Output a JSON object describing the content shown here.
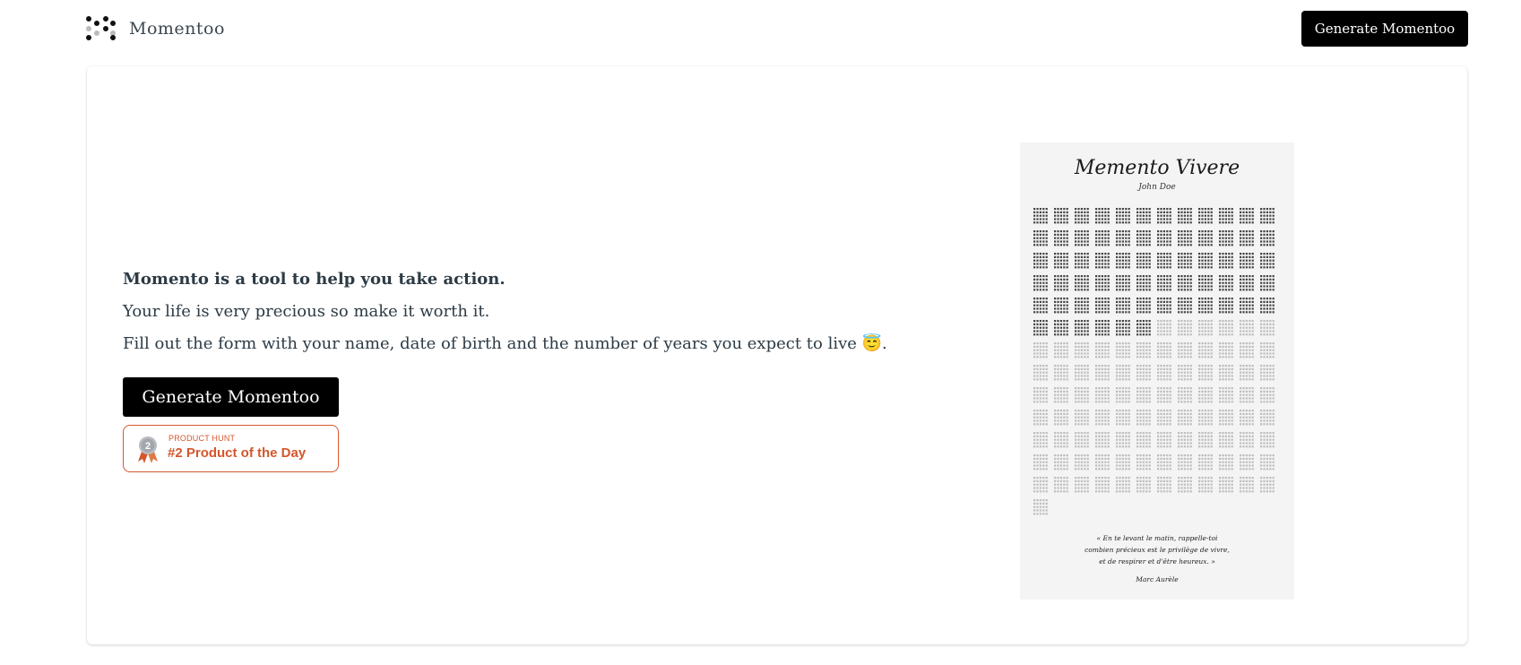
{
  "header": {
    "brand_name": "Momentoo",
    "logo_icon": "dots-logo-icon",
    "cta_label": "Generate Momentoo"
  },
  "main": {
    "lead": "Momento is a tool to help you take action.",
    "line2": "Your life is very precious so make it worth it.",
    "line3": "Fill out the form with your name, date of birth and the number of years you expect to live 😇.",
    "cta_label": "Generate Momentoo",
    "product_hunt": {
      "label_small": "PRODUCT HUNT",
      "label_big": "#2 Product of the Day",
      "icon": "silver-medal-icon",
      "medal_number": "2",
      "color": "#d4572c"
    }
  },
  "poster": {
    "title": "Memento Vivere",
    "name": "John Doe",
    "quote": "« En te levant le matin, rappelle-toi combien précieux est le privilège de vivre, et de respirer et d'être heureux. »",
    "author": "Marc Aurèle",
    "grid": {
      "columns": 12,
      "rows": 13,
      "filled_rows": 5,
      "filled_in_last_row": 6,
      "extra_row_blocks": 1
    }
  },
  "colors": {
    "primary_button": "#000000",
    "text": "#2d3b45",
    "accent": "#d4572c",
    "poster_bg": "#f4f4f4"
  }
}
